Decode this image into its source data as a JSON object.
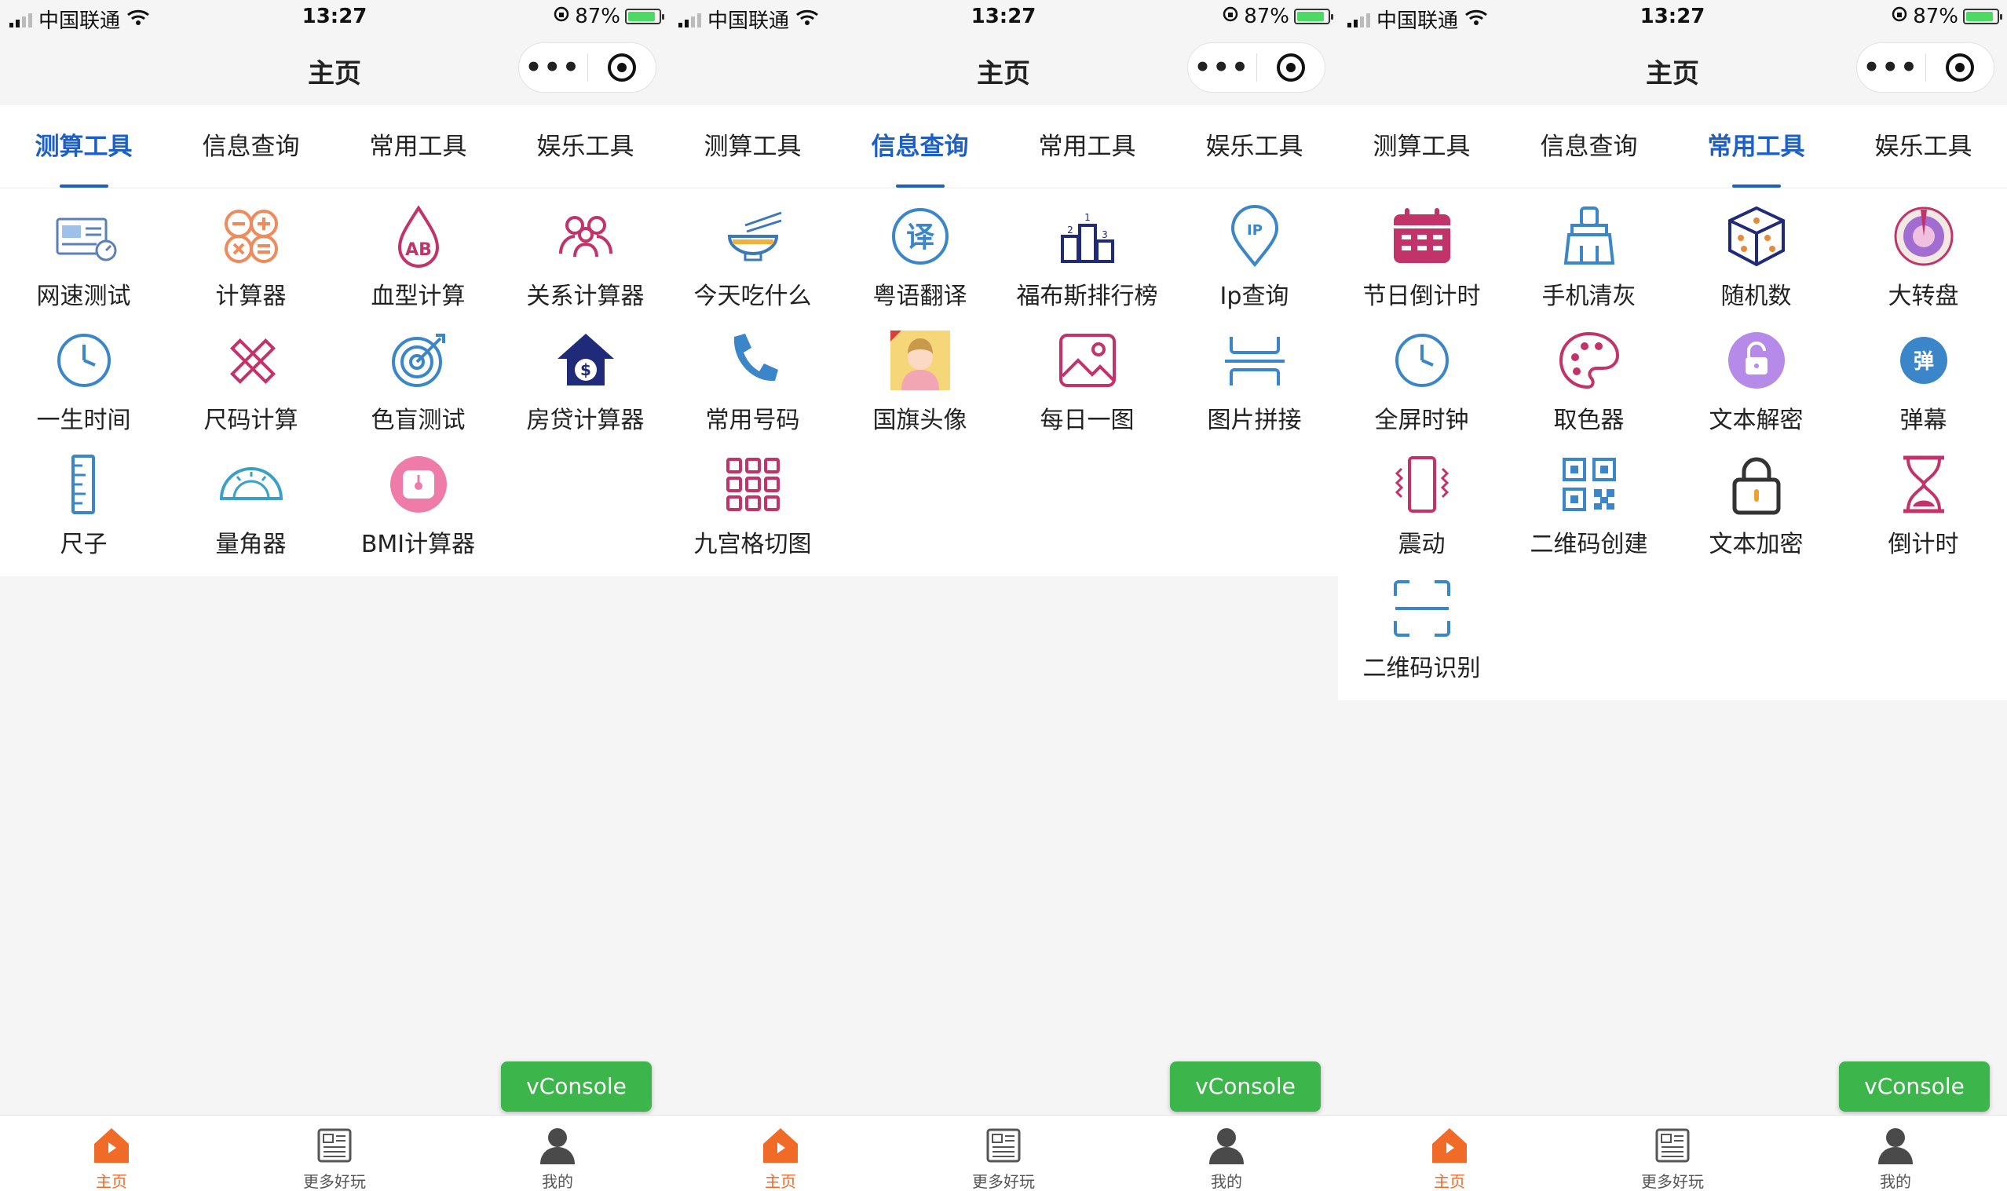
{
  "status_bar": {
    "carrier": "中国联通",
    "time": "13:27",
    "battery": "87%"
  },
  "nav": {
    "title": "主页",
    "more_glyph": "•••"
  },
  "tabs": [
    "测算工具",
    "信息查询",
    "常用工具",
    "娱乐工具"
  ],
  "screens": [
    {
      "active_tab": 0,
      "items": [
        {
          "label": "网速测试",
          "icon": "speed-test-icon"
        },
        {
          "label": "计算器",
          "icon": "calculator-icon"
        },
        {
          "label": "血型计算",
          "icon": "blood-type-icon"
        },
        {
          "label": "关系计算器",
          "icon": "relation-icon"
        },
        {
          "label": "一生时间",
          "icon": "clock-icon"
        },
        {
          "label": "尺码计算",
          "icon": "ruler-pencil-icon"
        },
        {
          "label": "色盲测试",
          "icon": "target-icon"
        },
        {
          "label": "房贷计算器",
          "icon": "house-loan-icon"
        },
        {
          "label": "尺子",
          "icon": "ruler-icon"
        },
        {
          "label": "量角器",
          "icon": "protractor-icon"
        },
        {
          "label": "BMI计算器",
          "icon": "scale-icon"
        }
      ]
    },
    {
      "active_tab": 1,
      "items": [
        {
          "label": "今天吃什么",
          "icon": "bowl-icon"
        },
        {
          "label": "粤语翻译",
          "icon": "translate-icon"
        },
        {
          "label": "福布斯排行榜",
          "icon": "podium-icon"
        },
        {
          "label": "Ip查询",
          "icon": "ip-pin-icon"
        },
        {
          "label": "常用号码",
          "icon": "phone-icon"
        },
        {
          "label": "国旗头像",
          "icon": "flag-avatar-icon"
        },
        {
          "label": "每日一图",
          "icon": "image-icon"
        },
        {
          "label": "图片拼接",
          "icon": "image-join-icon"
        },
        {
          "label": "九宫格切图",
          "icon": "grid-icon"
        }
      ]
    },
    {
      "active_tab": 2,
      "items": [
        {
          "label": "节日倒计时",
          "icon": "calendar-icon"
        },
        {
          "label": "手机清灰",
          "icon": "brush-icon"
        },
        {
          "label": "随机数",
          "icon": "dice-icon"
        },
        {
          "label": "大转盘",
          "icon": "wheel-icon"
        },
        {
          "label": "全屏时钟",
          "icon": "clock-icon"
        },
        {
          "label": "取色器",
          "icon": "palette-icon"
        },
        {
          "label": "文本解密",
          "icon": "unlock-icon"
        },
        {
          "label": "弹幕",
          "icon": "danmu-icon",
          "badge": "弹"
        },
        {
          "label": "震动",
          "icon": "vibrate-icon"
        },
        {
          "label": "二维码创建",
          "icon": "qrcode-icon"
        },
        {
          "label": "文本加密",
          "icon": "lock-icon"
        },
        {
          "label": "倒计时",
          "icon": "hourglass-icon"
        },
        {
          "label": "二维码识别",
          "icon": "scan-icon"
        }
      ]
    }
  ],
  "vconsole": "vConsole",
  "tabbar": [
    {
      "label": "主页",
      "icon": "home-icon",
      "active": true
    },
    {
      "label": "更多好玩",
      "icon": "news-icon",
      "active": false
    },
    {
      "label": "我的",
      "icon": "user-icon",
      "active": false
    }
  ],
  "colors": {
    "accent": "#1e5fc4",
    "tab_active": "#f06a28",
    "vconsole": "#3cb64a"
  }
}
